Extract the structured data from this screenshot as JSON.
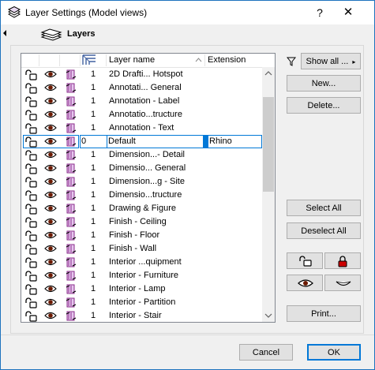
{
  "window": {
    "title": "Layer Settings (Model views)",
    "help_label": "?",
    "close_label": "✕"
  },
  "section": {
    "title": "Layers"
  },
  "table": {
    "columns": {
      "name": "Layer name",
      "extension": "Extension"
    },
    "rows": [
      {
        "num": "1",
        "name": "2D Drafti... Hotspot",
        "ext": ""
      },
      {
        "num": "1",
        "name": "Annotati... General",
        "ext": ""
      },
      {
        "num": "1",
        "name": "Annotation - Label",
        "ext": ""
      },
      {
        "num": "1",
        "name": "Annotatio...tructure",
        "ext": ""
      },
      {
        "num": "1",
        "name": "Annotation - Text",
        "ext": ""
      },
      {
        "num": "0",
        "name": "Default",
        "ext": "Rhino",
        "selected": true
      },
      {
        "num": "1",
        "name": "Dimension...- Detail",
        "ext": ""
      },
      {
        "num": "1",
        "name": "Dimensio... General",
        "ext": ""
      },
      {
        "num": "1",
        "name": "Dimension...g - Site",
        "ext": ""
      },
      {
        "num": "1",
        "name": "Dimensio...tructure",
        "ext": ""
      },
      {
        "num": "1",
        "name": "Drawing & Figure",
        "ext": ""
      },
      {
        "num": "1",
        "name": "Finish - Ceiling",
        "ext": ""
      },
      {
        "num": "1",
        "name": "Finish - Floor",
        "ext": ""
      },
      {
        "num": "1",
        "name": "Finish - Wall",
        "ext": ""
      },
      {
        "num": "1",
        "name": "Interior ...quipment",
        "ext": ""
      },
      {
        "num": "1",
        "name": "Interior - Furniture",
        "ext": ""
      },
      {
        "num": "1",
        "name": "Interior - Lamp",
        "ext": ""
      },
      {
        "num": "1",
        "name": "Interior - Partition",
        "ext": ""
      },
      {
        "num": "1",
        "name": "Interior - Stair",
        "ext": ""
      }
    ]
  },
  "buttons": {
    "show_all": "Show all ...",
    "show_all_arrow": "▸",
    "new": "New...",
    "delete": "Delete...",
    "select_all": "Select All",
    "deselect_all": "Deselect All",
    "print": "Print...",
    "cancel": "Cancel",
    "ok": "OK"
  },
  "colors": {
    "eye": "#6b1a00",
    "lock": "#000000",
    "pen": "#8a2a8a",
    "selected_border": "#0078d7",
    "accent": "#0078d7"
  }
}
